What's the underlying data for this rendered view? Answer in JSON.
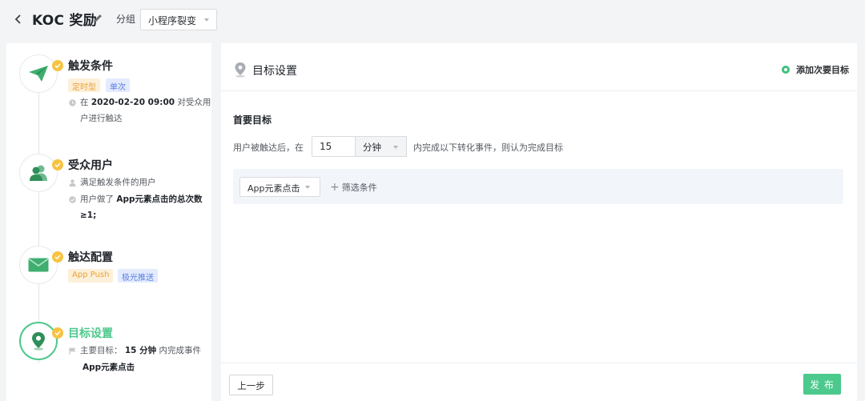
{
  "header": {
    "title": "KOC 奖励",
    "group_label": "分组",
    "group_value": "小程序裂变"
  },
  "steps": [
    {
      "title": "触发条件",
      "tags": [
        "定时型",
        "单次"
      ],
      "details": [
        {
          "prefix": "在 ",
          "bold": "2020-02-20 09:00",
          "suffix": " 对受众用"
        },
        {
          "text": "户进行触达"
        }
      ]
    },
    {
      "title": "受众用户",
      "details": [
        {
          "text": "满足触发条件的用户"
        },
        {
          "prefix": "用户做了 ",
          "bold": "App元素点击的总次数"
        },
        {
          "bold": "≥1;"
        }
      ]
    },
    {
      "title": "触达配置",
      "tags": [
        "App Push",
        "极光推送"
      ]
    },
    {
      "title": "目标设置",
      "details": [
        {
          "prefix": "主要目标： ",
          "bold": "15 分钟",
          "suffix": " 内完成事件"
        },
        {
          "bold": "App元素点击"
        }
      ]
    }
  ],
  "main": {
    "title": "目标设置",
    "add_goal": "添加次要目标",
    "section_title": "首要目标",
    "sentence_before": "用户被触达后，在",
    "minutes_value": "15",
    "unit_value": "分钟",
    "sentence_after": "内完成以下转化事件，则认为完成目标",
    "event_value": "App元素点击",
    "filter_label": "筛选条件",
    "prev_button": "上一步",
    "publish_button": "发 布"
  },
  "colors": {
    "accent": "#4cc98c",
    "badge": "#f6c343",
    "tag_orange": "#e8a23a",
    "tag_blue": "#5b7ee5"
  }
}
